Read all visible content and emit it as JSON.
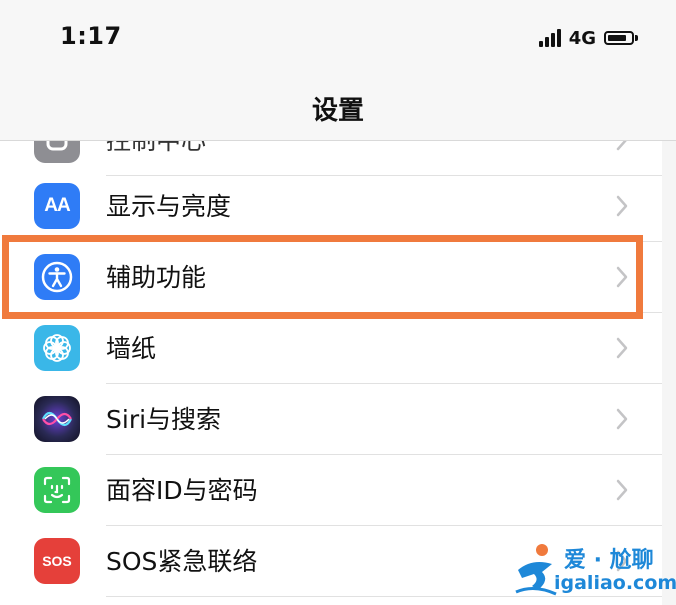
{
  "status_bar": {
    "time": "1:17",
    "network": "4G",
    "battery_level": 0.8
  },
  "nav": {
    "title": "设置"
  },
  "settings": {
    "items": [
      {
        "label": "控制中心",
        "icon": "control-center-icon",
        "icon_color": "#8e8e93"
      },
      {
        "label": "显示与亮度",
        "icon": "display-brightness-icon",
        "icon_color": "#2f7cf6",
        "icon_text": "AA"
      },
      {
        "label": "辅助功能",
        "icon": "accessibility-icon",
        "icon_color": "#2f7cf6"
      },
      {
        "label": "墙纸",
        "icon": "wallpaper-flower-icon",
        "icon_color": "#3ab7e8"
      },
      {
        "label": "Siri与搜索",
        "icon": "siri-icon",
        "icon_color": "#222233"
      },
      {
        "label": "面容ID与密码",
        "icon": "face-id-icon",
        "icon_color": "#34c759"
      },
      {
        "label": "SOS紧急联络",
        "icon": "sos-icon",
        "icon_color": "#e5403a",
        "icon_text": "SOS"
      }
    ],
    "highlighted_index": 2,
    "highlight_color": "#f07a3d"
  },
  "watermark": {
    "brand": "爱 · 尬聊",
    "url": "igaliao.com",
    "color": "#1e88d8"
  }
}
